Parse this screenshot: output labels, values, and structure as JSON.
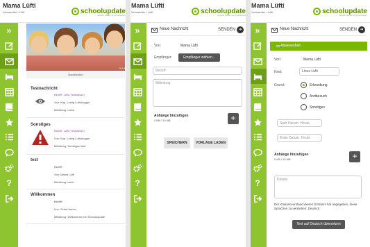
{
  "header": {
    "user_name": "Mama Lüfti",
    "role_text": "Verwandter • Lüfti",
    "brand": "schoolupdate",
    "brand_sub": "einfach besser kommunizieren"
  },
  "sidebar": {
    "items": [
      {
        "icon": "expand-icon",
        "label": "»"
      },
      {
        "icon": "edit-icon"
      },
      {
        "icon": "mail-icon"
      },
      {
        "icon": "bed-icon"
      },
      {
        "icon": "calendar-icon"
      },
      {
        "icon": "book-icon"
      },
      {
        "icon": "star-icon"
      },
      {
        "icon": "list-icon"
      },
      {
        "icon": "chat-icon"
      },
      {
        "icon": "settings-icon"
      },
      {
        "icon": "help-icon",
        "label": "?"
      },
      {
        "icon": "logout-icon"
      }
    ]
  },
  "inbox": {
    "caption": "Nachrichten",
    "messages": [
      {
        "title": "Testnachricht",
        "lines": [
          "Betrifft: Lüfti (Testklasse)",
          "Von: Kap. Lustig Luftzeugger",
          "Mitteilung: Liebe"
        ],
        "icon": "eye-icon"
      },
      {
        "title": "Sonstiges",
        "lines": [
          "Betrifft: Lüfti (Testklasse)",
          "Von: Kap. Lustig Luftzeugger",
          "Mitteilung: Sonstiges Mail"
        ],
        "icon": "warning-icon"
      },
      {
        "title": "test",
        "lines": [
          "Betrifft:",
          "Von: Mama Lüfti",
          "Mitteilung: testrt"
        ]
      },
      {
        "title": "Willkommen",
        "lines": [
          "Betrifft:",
          "Von: Schul-Admin",
          "Mitteilung: Willkommen bei Schoolupdate"
        ]
      }
    ]
  },
  "compose": {
    "title": "Neue Nachricht",
    "send_label": "SENDEN",
    "from_label": "Von:",
    "from_value": "Mama Lüfti",
    "to_label": "Empfänger:",
    "choose_recipient": "Empfänger wählen...",
    "subject_placeholder": "Betreff",
    "message_placeholder": "Mitteilung",
    "attach_label": "Anhänge hinzufügen",
    "attach_size": "0 KB / 10 MB",
    "save_label": "SPEICHERN",
    "template_label": "VORLAGE LADEN"
  },
  "absence": {
    "title": "Neue Nachricht",
    "send_label": "SENDEN",
    "bar_label": "Abwesenheit",
    "from_label": "Von:",
    "from_value": "Mama Lüfti",
    "child_label": "Kind:",
    "child_value": "Linus Lüfti",
    "reason_label": "Grund:",
    "reasons": [
      "Erkrankung",
      "Arztbesuch",
      "Sonstiges"
    ],
    "selected_reason": "Erkrankung",
    "start_placeholder": "Start Datum: Heute",
    "end_placeholder": "Ende Datum: Heute",
    "attach_label": "Anhänge hinzufügen",
    "attach_size": "0 KB / 10 MB",
    "details_placeholder": "Details",
    "notice": "Der Klassenvorstand dieses Schülers hat angegeben, diese Sprachen zu verstehen: Deutsch",
    "translate_label": "Text auf Deutsch übersetzen"
  },
  "colors": {
    "sidebar": "#8ec42f",
    "sidebar_active": "#6ea015",
    "brand_green": "#7ab800"
  }
}
